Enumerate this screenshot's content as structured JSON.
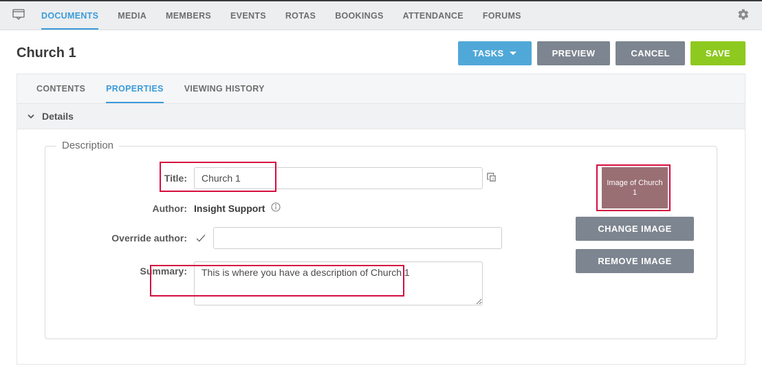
{
  "topnav": {
    "items": [
      {
        "label": "DOCUMENTS",
        "active": true
      },
      {
        "label": "MEDIA"
      },
      {
        "label": "MEMBERS"
      },
      {
        "label": "EVENTS"
      },
      {
        "label": "ROTAS"
      },
      {
        "label": "BOOKINGS"
      },
      {
        "label": "ATTENDANCE"
      },
      {
        "label": "FORUMS"
      }
    ]
  },
  "page_title": "Church 1",
  "buttons": {
    "tasks": "TASKS",
    "preview": "PREVIEW",
    "cancel": "CANCEL",
    "save": "SAVE"
  },
  "subtabs": {
    "items": [
      {
        "label": "CONTENTS"
      },
      {
        "label": "PROPERTIES",
        "active": true
      },
      {
        "label": "VIEWING HISTORY"
      }
    ]
  },
  "panel": {
    "title": "Details"
  },
  "form": {
    "fieldset_legend": "Description",
    "labels": {
      "title": "Title:",
      "author": "Author:",
      "override_author": "Override author:",
      "summary": "Summary:"
    },
    "values": {
      "title": "Church 1",
      "author": "Insight Support",
      "override_author": "",
      "summary": "This is where you have a description of Church 1"
    }
  },
  "image": {
    "caption": "Image of Church 1",
    "change": "CHANGE IMAGE",
    "remove": "REMOVE IMAGE"
  }
}
